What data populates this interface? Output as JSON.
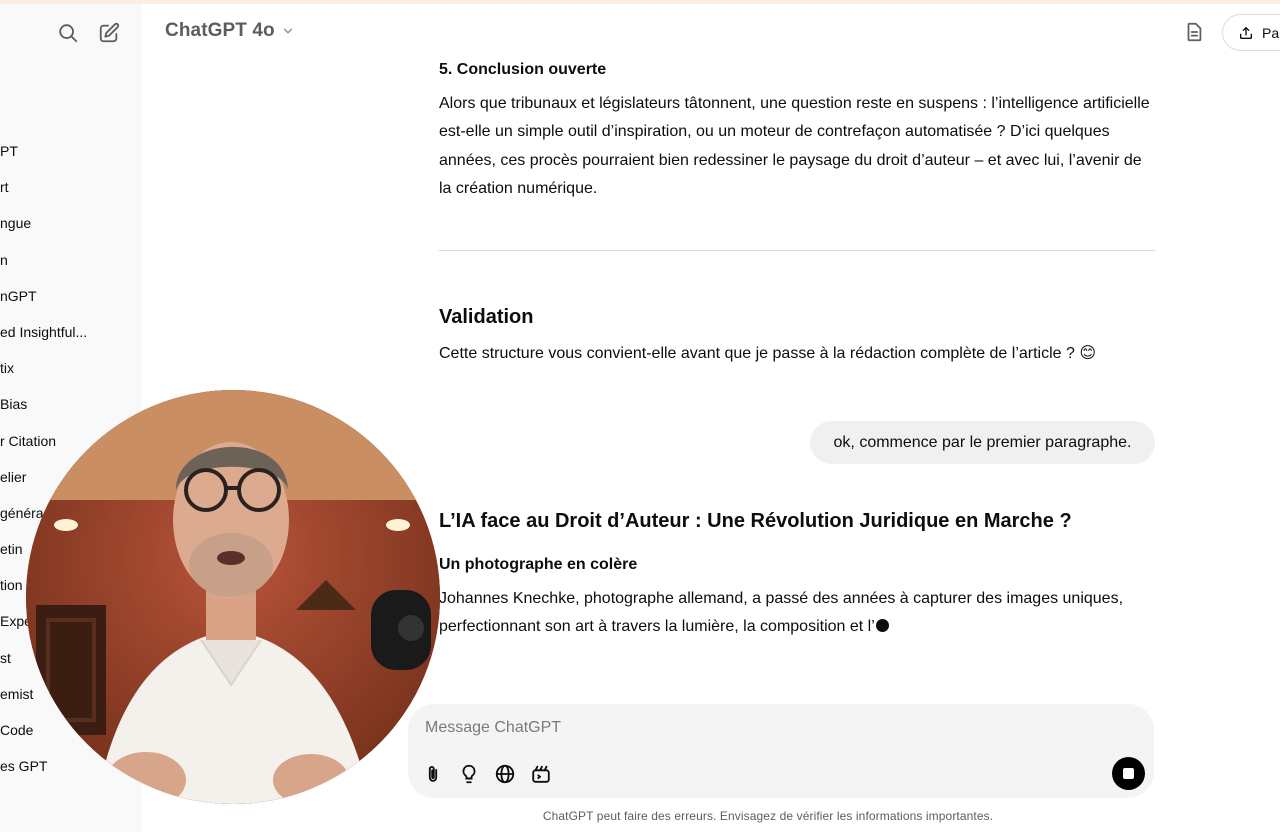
{
  "sidebar": {
    "items": [
      "PT",
      "rt",
      "ngue",
      "n",
      "nGPT",
      "ed Insightful...",
      "tix",
      "Bias",
      "r Citation",
      "elier",
      " généra",
      "etin",
      "tion",
      "Expe",
      "st",
      "emist",
      "Code",
      "es GPT"
    ]
  },
  "header": {
    "model": "ChatGPT 4o",
    "share_label": "Par"
  },
  "conversation": {
    "section5_title": "5. Conclusion ouverte",
    "section5_text": "Alors que tribunaux et législateurs tâtonnent, une question reste en suspens : l’intelligence artificielle est-elle un simple outil d’inspiration, ou un moteur de contrefaçon automatisée ? D’ici quelques années, ces procès pourraient bien redessiner le paysage du droit d’auteur – et avec lui, l’avenir de la création numérique.",
    "validation_title": "Validation",
    "validation_text": "Cette structure vous convient-elle avant que je passe à la rédaction complète de l’article ? 😊",
    "user_message": "ok, commence par le premier paragraphe.",
    "article_title": "L’IA face au Droit d’Auteur : Une Révolution Juridique en Marche ?",
    "article_subtitle": "Un photographe en colère",
    "article_text": "Johannes Knechke, photographe allemand, a passé des années à capturer des images uniques, perfectionnant son art à travers la lumière, la composition et l’"
  },
  "composer": {
    "placeholder": "Message ChatGPT",
    "tools": [
      "paperclip-icon",
      "lightbulb-icon",
      "globe-icon",
      "canvas-icon"
    ]
  },
  "disclaimer": "ChatGPT peut faire des erreurs. Envisagez de vérifier les informations importantes.",
  "colors": {
    "accent_bar": "#fbeee6",
    "sidebar_bg": "#f9f9f9",
    "bubble_bg": "#f0f0f0",
    "composer_bg": "#f4f4f4"
  }
}
